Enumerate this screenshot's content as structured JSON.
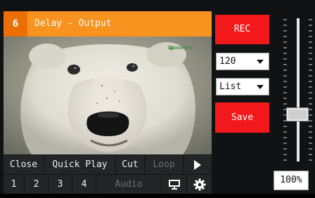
{
  "output": {
    "number": "6",
    "title": "Delay - Output",
    "watermark": "Discovery"
  },
  "controls": {
    "close": "Close",
    "quick_play": "Quick Play",
    "cut": "Cut",
    "loop": "Loop",
    "play_icon": "play-icon",
    "cues": [
      "1",
      "2",
      "3",
      "4"
    ],
    "audio": "Audio",
    "monitor_icon": "monitor-icon",
    "settings_icon": "gear-icon"
  },
  "side": {
    "rec": "REC",
    "duration": "120",
    "mode": "List",
    "save": "Save"
  },
  "volume": {
    "level": 0.31,
    "percent": "100%"
  },
  "colors": {
    "title_bg": "#f7931e",
    "title_num_bg": "#ec6f06",
    "rec_bg": "#f2181b",
    "save_bg": "#f2181b"
  }
}
